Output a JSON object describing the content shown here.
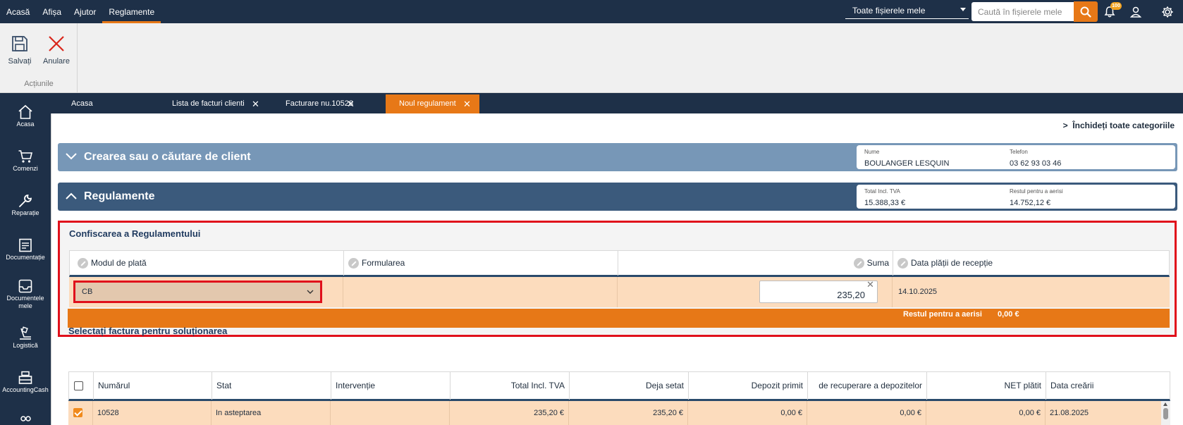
{
  "topnav": {
    "items": [
      {
        "label": "Acasă",
        "active": false
      },
      {
        "label": "Afișa",
        "active": false
      },
      {
        "label": "Ajutor",
        "active": false
      },
      {
        "label": "Reglamente",
        "active": true
      }
    ],
    "scope_select": "Toate fișierele mele",
    "search_placeholder": "Caută în fișierele mele",
    "notification_count": "100"
  },
  "ribbon": {
    "save_label": "Salvați",
    "cancel_label": "Anulare",
    "group_label": "Acțiunile"
  },
  "sidenav": {
    "items": [
      {
        "label": "Acasa",
        "icon": "home-icon"
      },
      {
        "label": "Comenzi",
        "icon": "cart-icon"
      },
      {
        "label": "Reparație",
        "icon": "wrench-icon"
      },
      {
        "label": "Documentație",
        "icon": "document-icon"
      },
      {
        "label": "Documentele mele",
        "icon": "inbox-icon"
      },
      {
        "label": "Logistică",
        "icon": "logistics-icon"
      },
      {
        "label": "AccountingCash",
        "icon": "cash-register-icon"
      }
    ]
  },
  "tabs": [
    {
      "label": "Acasa",
      "closable": false,
      "active": false
    },
    {
      "label": "Lista de facturi clienti",
      "closable": true,
      "active": false
    },
    {
      "label": "Facturare nu.10528",
      "closable": true,
      "active": false
    },
    {
      "label": "Noul regulament",
      "closable": true,
      "active": true
    }
  ],
  "content": {
    "close_all": "Închideți toate categoriile",
    "close_all_prefix": ">",
    "customer_section": {
      "title": "Crearea sau o căutare de client",
      "name_label": "Nume",
      "name_value": "BOULANGER LESQUIN",
      "phone_label": "Telefon",
      "phone_value": "03 62 93 03 46"
    },
    "settlement_section": {
      "title": "Regulamente",
      "total_label": "Total Incl. TVA",
      "total_value": "15.388,33 €",
      "rest_label": "Restul pentru a aerisi",
      "rest_value": "14.752,12 €"
    },
    "entry": {
      "title": "Confiscarea a Regulamentului",
      "columns": [
        "Modul de plată",
        "Formularea",
        "Suma",
        "Data plății de recepție"
      ],
      "payment_mode": "CB",
      "formulation": "",
      "amount": "235,20",
      "date": "14.10.2025",
      "rest_label": "Restul pentru a aerisi",
      "rest_value": "0,00 €"
    },
    "invoices": {
      "title": "Selectați factura pentru soluționarea",
      "columns": [
        "Numărul",
        "Stat",
        "Intervenție",
        "Total Incl. TVA",
        "Deja setat",
        "Depozit primit",
        "de recuperare a depozitelor",
        "NET plătit",
        "Data creării"
      ],
      "rows": [
        {
          "checked": true,
          "number": "10528",
          "status": "In asteptarea",
          "intervention": "",
          "total": "235,20 €",
          "already_set": "235,20 €",
          "deposit_received": "0,00 €",
          "deposit_recovery": "0,00 €",
          "net_paid": "0,00 €",
          "created": "21.08.2025"
        }
      ]
    }
  },
  "colors": {
    "navy": "#1e3048",
    "orange": "#e77817",
    "section_light": "#7797b7",
    "section_dark": "#3b5a7c",
    "highlight_red": "#e0101b",
    "row_peach": "#fcdcbd"
  }
}
